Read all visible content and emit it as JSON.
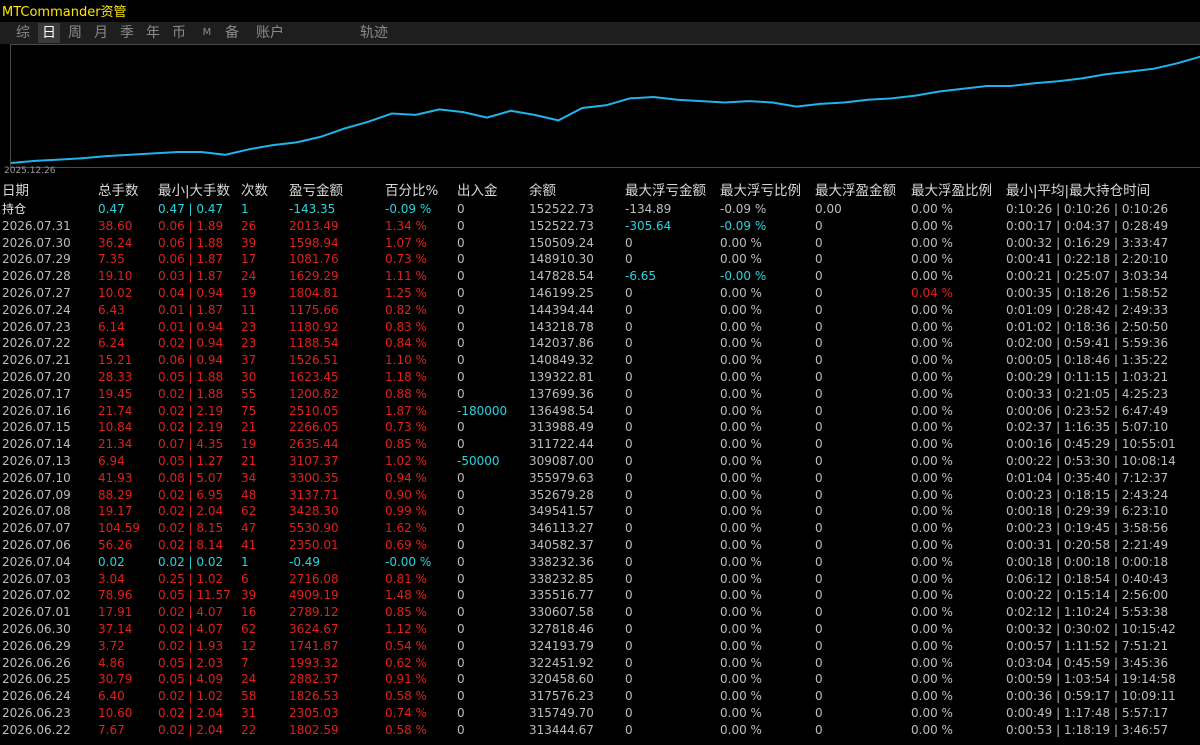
{
  "app": {
    "title": "MTCommander资管"
  },
  "tabs": [
    {
      "label": "综"
    },
    {
      "label": "日",
      "active": true
    },
    {
      "label": "周"
    },
    {
      "label": "月"
    },
    {
      "label": "季"
    },
    {
      "label": "年"
    },
    {
      "label": "币"
    },
    {
      "label": "M",
      "small": true
    },
    {
      "label": "备"
    },
    {
      "label": "账户"
    },
    {
      "label": "轨迹"
    }
  ],
  "chart": {
    "date_label": "2025.12.26",
    "line_color": "#1fb4ee"
  },
  "chart_data": {
    "type": "line",
    "title": "",
    "xlabel": "",
    "ylabel": "",
    "x_start_label": "2025.12.26",
    "values": [
      0.0,
      0.3,
      0.5,
      0.7,
      1.0,
      1.2,
      1.4,
      1.6,
      1.6,
      1.2,
      2.0,
      2.6,
      3.0,
      3.8,
      5.0,
      6.0,
      7.2,
      7.0,
      7.8,
      7.4,
      6.6,
      7.6,
      7.0,
      6.2,
      8.0,
      8.4,
      9.4,
      9.6,
      9.2,
      9.0,
      8.8,
      9.0,
      8.8,
      8.2,
      8.6,
      8.8,
      9.2,
      9.4,
      9.8,
      10.4,
      10.8,
      11.2,
      11.2,
      11.6,
      11.9,
      12.3,
      12.9,
      13.3,
      13.7,
      14.5,
      15.5
    ],
    "ylim": [
      0,
      16
    ]
  },
  "columns": [
    "日期",
    "总手数",
    "最小|大手数",
    "次数",
    "盈亏金额",
    "百分比%",
    "出入金",
    "余额",
    "最大浮亏金额",
    "最大浮亏比例",
    "最大浮盈金额",
    "最大浮盈比例",
    "最小|平均|最大持仓时间"
  ],
  "rows": [
    {
      "date": "持仓",
      "lots": "0.47",
      "minmax": "0.47 | 0.47",
      "count": "1",
      "pnl": "-143.35",
      "pct": "-0.09 %",
      "io": "0",
      "bal": "152522.73",
      "mdd": "-134.89",
      "mddp": "-0.09 %",
      "mfp": "0.00",
      "mfpp": "0.00 %",
      "time": "0:10:26 | 0:10:26 | 0:10:26",
      "cls": "cyan",
      "dcls": "white"
    },
    {
      "date": "2026.07.31",
      "lots": "38.60",
      "minmax": "0.06 | 1.89",
      "count": "26",
      "pnl": "2013.49",
      "pct": "1.34 %",
      "io": "0",
      "bal": "152522.73",
      "mdd": "-305.64",
      "mddp": "-0.09 %",
      "mfp": "0",
      "mfpp": "0.00 %",
      "time": "0:00:17 | 0:04:37 | 0:28:49",
      "cls": "red",
      "mddcls": "cyan",
      "mddpcls": "cyan"
    },
    {
      "date": "2026.07.30",
      "lots": "36.24",
      "minmax": "0.06 | 1.88",
      "count": "39",
      "pnl": "1598.94",
      "pct": "1.07 %",
      "io": "0",
      "bal": "150509.24",
      "mdd": "0",
      "mddp": "0.00 %",
      "mfp": "0",
      "mfpp": "0.00 %",
      "time": "0:00:32 | 0:16:29 | 3:33:47",
      "cls": "red"
    },
    {
      "date": "2026.07.29",
      "lots": "7.35",
      "minmax": "0.06 | 1.87",
      "count": "17",
      "pnl": "1081.76",
      "pct": "0.73 %",
      "io": "0",
      "bal": "148910.30",
      "mdd": "0",
      "mddp": "0.00 %",
      "mfp": "0",
      "mfpp": "0.00 %",
      "time": "0:00:41 | 0:22:18 | 2:20:10",
      "cls": "red"
    },
    {
      "date": "2026.07.28",
      "lots": "19.10",
      "minmax": "0.03 | 1.87",
      "count": "24",
      "pnl": "1629.29",
      "pct": "1.11 %",
      "io": "0",
      "bal": "147828.54",
      "mdd": "-6.65",
      "mddp": "-0.00 %",
      "mfp": "0",
      "mfpp": "0.00 %",
      "time": "0:00:21 | 0:25:07 | 3:03:34",
      "cls": "red",
      "mddcls": "cyan",
      "mddpcls": "cyan"
    },
    {
      "date": "2026.07.27",
      "lots": "10.02",
      "minmax": "0.04 | 0.94",
      "count": "19",
      "pnl": "1804.81",
      "pct": "1.25 %",
      "io": "0",
      "bal": "146199.25",
      "mdd": "0",
      "mddp": "0.00 %",
      "mfp": "0",
      "mfpp": "0.04 %",
      "time": "0:00:35 | 0:18:26 | 1:58:52",
      "cls": "red",
      "mfppcls": "red"
    },
    {
      "date": "2026.07.24",
      "lots": "6.43",
      "minmax": "0.01 | 1.87",
      "count": "11",
      "pnl": "1175.66",
      "pct": "0.82 %",
      "io": "0",
      "bal": "144394.44",
      "mdd": "0",
      "mddp": "0.00 %",
      "mfp": "0",
      "mfpp": "0.00 %",
      "time": "0:01:09 | 0:28:42 | 2:49:33",
      "cls": "red"
    },
    {
      "date": "2026.07.23",
      "lots": "6.14",
      "minmax": "0.01 | 0.94",
      "count": "23",
      "pnl": "1180.92",
      "pct": "0.83 %",
      "io": "0",
      "bal": "143218.78",
      "mdd": "0",
      "mddp": "0.00 %",
      "mfp": "0",
      "mfpp": "0.00 %",
      "time": "0:01:02 | 0:18:36 | 2:50:50",
      "cls": "red"
    },
    {
      "date": "2026.07.22",
      "lots": "6.24",
      "minmax": "0.02 | 0.94",
      "count": "23",
      "pnl": "1188.54",
      "pct": "0.84 %",
      "io": "0",
      "bal": "142037.86",
      "mdd": "0",
      "mddp": "0.00 %",
      "mfp": "0",
      "mfpp": "0.00 %",
      "time": "0:02:00 | 0:59:41 | 5:59:36",
      "cls": "red"
    },
    {
      "date": "2026.07.21",
      "lots": "15.21",
      "minmax": "0.06 | 0.94",
      "count": "37",
      "pnl": "1526.51",
      "pct": "1.10 %",
      "io": "0",
      "bal": "140849.32",
      "mdd": "0",
      "mddp": "0.00 %",
      "mfp": "0",
      "mfpp": "0.00 %",
      "time": "0:00:05 | 0:18:46 | 1:35:22",
      "cls": "red"
    },
    {
      "date": "2026.07.20",
      "lots": "28.33",
      "minmax": "0.05 | 1.88",
      "count": "30",
      "pnl": "1623.45",
      "pct": "1.18 %",
      "io": "0",
      "bal": "139322.81",
      "mdd": "0",
      "mddp": "0.00 %",
      "mfp": "0",
      "mfpp": "0.00 %",
      "time": "0:00:29 | 0:11:15 | 1:03:21",
      "cls": "red"
    },
    {
      "date": "2026.07.17",
      "lots": "19.45",
      "minmax": "0.02 | 1.88",
      "count": "55",
      "pnl": "1200.82",
      "pct": "0.88 %",
      "io": "0",
      "bal": "137699.36",
      "mdd": "0",
      "mddp": "0.00 %",
      "mfp": "0",
      "mfpp": "0.00 %",
      "time": "0:00:33 | 0:21:05 | 4:25:23",
      "cls": "red"
    },
    {
      "date": "2026.07.16",
      "lots": "21.74",
      "minmax": "0.02 | 2.19",
      "count": "75",
      "pnl": "2510.05",
      "pct": "1.87 %",
      "io": "-180000",
      "bal": "136498.54",
      "mdd": "0",
      "mddp": "0.00 %",
      "mfp": "0",
      "mfpp": "0.00 %",
      "time": "0:00:06 | 0:23:52 | 6:47:49",
      "cls": "red",
      "iocls": "cyan"
    },
    {
      "date": "2026.07.15",
      "lots": "10.84",
      "minmax": "0.02 | 2.19",
      "count": "21",
      "pnl": "2266.05",
      "pct": "0.73 %",
      "io": "0",
      "bal": "313988.49",
      "mdd": "0",
      "mddp": "0.00 %",
      "mfp": "0",
      "mfpp": "0.00 %",
      "time": "0:02:37 | 1:16:35 | 5:07:10",
      "cls": "red"
    },
    {
      "date": "2026.07.14",
      "lots": "21.34",
      "minmax": "0.07 | 4.35",
      "count": "19",
      "pnl": "2635.44",
      "pct": "0.85 %",
      "io": "0",
      "bal": "311722.44",
      "mdd": "0",
      "mddp": "0.00 %",
      "mfp": "0",
      "mfpp": "0.00 %",
      "time": "0:00:16 | 0:45:29 | 10:55:01",
      "cls": "red"
    },
    {
      "date": "2026.07.13",
      "lots": "6.94",
      "minmax": "0.05 | 1.27",
      "count": "21",
      "pnl": "3107.37",
      "pct": "1.02 %",
      "io": "-50000",
      "bal": "309087.00",
      "mdd": "0",
      "mddp": "0.00 %",
      "mfp": "0",
      "mfpp": "0.00 %",
      "time": "0:00:22 | 0:53:30 | 10:08:14",
      "cls": "red",
      "iocls": "cyan"
    },
    {
      "date": "2026.07.10",
      "lots": "41.93",
      "minmax": "0.08 | 5.07",
      "count": "34",
      "pnl": "3300.35",
      "pct": "0.94 %",
      "io": "0",
      "bal": "355979.63",
      "mdd": "0",
      "mddp": "0.00 %",
      "mfp": "0",
      "mfpp": "0.00 %",
      "time": "0:01:04 | 0:35:40 | 7:12:37",
      "cls": "red"
    },
    {
      "date": "2026.07.09",
      "lots": "88.29",
      "minmax": "0.02 | 6.95",
      "count": "48",
      "pnl": "3137.71",
      "pct": "0.90 %",
      "io": "0",
      "bal": "352679.28",
      "mdd": "0",
      "mddp": "0.00 %",
      "mfp": "0",
      "mfpp": "0.00 %",
      "time": "0:00:23 | 0:18:15 | 2:43:24",
      "cls": "red"
    },
    {
      "date": "2026.07.08",
      "lots": "19.17",
      "minmax": "0.02 | 2.04",
      "count": "62",
      "pnl": "3428.30",
      "pct": "0.99 %",
      "io": "0",
      "bal": "349541.57",
      "mdd": "0",
      "mddp": "0.00 %",
      "mfp": "0",
      "mfpp": "0.00 %",
      "time": "0:00:18 | 0:29:39 | 6:23:10",
      "cls": "red"
    },
    {
      "date": "2026.07.07",
      "lots": "104.59",
      "minmax": "0.02 | 8.15",
      "count": "47",
      "pnl": "5530.90",
      "pct": "1.62 %",
      "io": "0",
      "bal": "346113.27",
      "mdd": "0",
      "mddp": "0.00 %",
      "mfp": "0",
      "mfpp": "0.00 %",
      "time": "0:00:23 | 0:19:45 | 3:58:56",
      "cls": "red"
    },
    {
      "date": "2026.07.06",
      "lots": "56.26",
      "minmax": "0.02 | 8.14",
      "count": "41",
      "pnl": "2350.01",
      "pct": "0.69 %",
      "io": "0",
      "bal": "340582.37",
      "mdd": "0",
      "mddp": "0.00 %",
      "mfp": "0",
      "mfpp": "0.00 %",
      "time": "0:00:31 | 0:20:58 | 2:21:49",
      "cls": "red"
    },
    {
      "date": "2026.07.04",
      "lots": "0.02",
      "minmax": "0.02 | 0.02",
      "count": "1",
      "pnl": "-0.49",
      "pct": "-0.00 %",
      "io": "0",
      "bal": "338232.36",
      "mdd": "0",
      "mddp": "0.00 %",
      "mfp": "0",
      "mfpp": "0.00 %",
      "time": "0:00:18 | 0:00:18 | 0:00:18",
      "cls": "cyan"
    },
    {
      "date": "2026.07.03",
      "lots": "3.04",
      "minmax": "0.25 | 1.02",
      "count": "6",
      "pnl": "2716.08",
      "pct": "0.81 %",
      "io": "0",
      "bal": "338232.85",
      "mdd": "0",
      "mddp": "0.00 %",
      "mfp": "0",
      "mfpp": "0.00 %",
      "time": "0:06:12 | 0:18:54 | 0:40:43",
      "cls": "red"
    },
    {
      "date": "2026.07.02",
      "lots": "78.96",
      "minmax": "0.05 | 11.57",
      "count": "39",
      "pnl": "4909.19",
      "pct": "1.48 %",
      "io": "0",
      "bal": "335516.77",
      "mdd": "0",
      "mddp": "0.00 %",
      "mfp": "0",
      "mfpp": "0.00 %",
      "time": "0:00:22 | 0:15:14 | 2:56:00",
      "cls": "red"
    },
    {
      "date": "2026.07.01",
      "lots": "17.91",
      "minmax": "0.02 | 4.07",
      "count": "16",
      "pnl": "2789.12",
      "pct": "0.85 %",
      "io": "0",
      "bal": "330607.58",
      "mdd": "0",
      "mddp": "0.00 %",
      "mfp": "0",
      "mfpp": "0.00 %",
      "time": "0:02:12 | 1:10:24 | 5:53:38",
      "cls": "red"
    },
    {
      "date": "2026.06.30",
      "lots": "37.14",
      "minmax": "0.02 | 4.07",
      "count": "62",
      "pnl": "3624.67",
      "pct": "1.12 %",
      "io": "0",
      "bal": "327818.46",
      "mdd": "0",
      "mddp": "0.00 %",
      "mfp": "0",
      "mfpp": "0.00 %",
      "time": "0:00:32 | 0:30:02 | 10:15:42",
      "cls": "red"
    },
    {
      "date": "2026.06.29",
      "lots": "3.72",
      "minmax": "0.02 | 1.93",
      "count": "12",
      "pnl": "1741.87",
      "pct": "0.54 %",
      "io": "0",
      "bal": "324193.79",
      "mdd": "0",
      "mddp": "0.00 %",
      "mfp": "0",
      "mfpp": "0.00 %",
      "time": "0:00:57 | 1:11:52 | 7:51:21",
      "cls": "red"
    },
    {
      "date": "2026.06.26",
      "lots": "4.86",
      "minmax": "0.05 | 2.03",
      "count": "7",
      "pnl": "1993.32",
      "pct": "0.62 %",
      "io": "0",
      "bal": "322451.92",
      "mdd": "0",
      "mddp": "0.00 %",
      "mfp": "0",
      "mfpp": "0.00 %",
      "time": "0:03:04 | 0:45:59 | 3:45:36",
      "cls": "red"
    },
    {
      "date": "2026.06.25",
      "lots": "30.79",
      "minmax": "0.05 | 4.09",
      "count": "24",
      "pnl": "2882.37",
      "pct": "0.91 %",
      "io": "0",
      "bal": "320458.60",
      "mdd": "0",
      "mddp": "0.00 %",
      "mfp": "0",
      "mfpp": "0.00 %",
      "time": "0:00:59 | 1:03:54 | 19:14:58",
      "cls": "red"
    },
    {
      "date": "2026.06.24",
      "lots": "6.40",
      "minmax": "0.02 | 1.02",
      "count": "58",
      "pnl": "1826.53",
      "pct": "0.58 %",
      "io": "0",
      "bal": "317576.23",
      "mdd": "0",
      "mddp": "0.00 %",
      "mfp": "0",
      "mfpp": "0.00 %",
      "time": "0:00:36 | 0:59:17 | 10:09:11",
      "cls": "red"
    },
    {
      "date": "2026.06.23",
      "lots": "10.60",
      "minmax": "0.02 | 2.04",
      "count": "31",
      "pnl": "2305.03",
      "pct": "0.74 %",
      "io": "0",
      "bal": "315749.70",
      "mdd": "0",
      "mddp": "0.00 %",
      "mfp": "0",
      "mfpp": "0.00 %",
      "time": "0:00:49 | 1:17:48 | 5:57:17",
      "cls": "red"
    },
    {
      "date": "2026.06.22",
      "lots": "7.67",
      "minmax": "0.02 | 2.04",
      "count": "22",
      "pnl": "1802.59",
      "pct": "0.58 %",
      "io": "0",
      "bal": "313444.67",
      "mdd": "0",
      "mddp": "0.00 %",
      "mfp": "0",
      "mfpp": "0.00 %",
      "time": "0:00:53 | 1:18:19 | 3:46:57",
      "cls": "red"
    }
  ]
}
